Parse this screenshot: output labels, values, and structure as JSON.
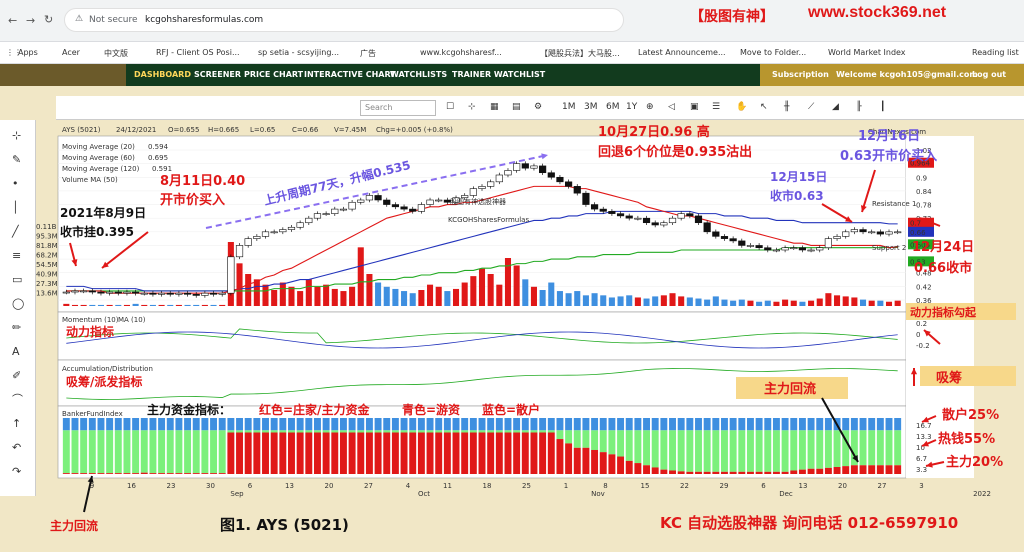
{
  "browser": {
    "url_security": "Not secure",
    "url": "kcgohsharesformulas.com",
    "banner_brand": "【股图有神】",
    "banner_site": "www.stock369.net",
    "bookmarks": [
      "Apps",
      "Acer",
      "中文版",
      "RFJ - Client OS Posi...",
      "sp setia - scsyijing...",
      "广告",
      "www.kcgohsharesf...",
      "【飓股兵法】大马股...",
      "Latest Announceme...",
      "Move to Folder...",
      "World Market Index",
      "Reading list"
    ]
  },
  "site_nav": {
    "items": [
      "DASHBOARD",
      "SCREENER",
      "PRICE CHART",
      "INTERACTIVE CHART",
      "WATCHLISTS",
      "TRAINER WATCHLIST"
    ],
    "subscription": "Subscription",
    "welcome": "Welcome kcgoh105@gmail.com",
    "logout": "Log out"
  },
  "toolbar": {
    "search_placeholder": "Search",
    "periods": [
      "1M",
      "3M",
      "6M",
      "1Y"
    ]
  },
  "quote": {
    "symbol": "AYS (5021)",
    "date": "24/12/2021",
    "open": "O=0.655",
    "high": "H=0.665",
    "low": "L=0.65",
    "close": "C=0.66",
    "volume": "V=7.45M",
    "change": "Chg=+0.005 (+0.8%)",
    "watermark": "ChartNexus.com"
  },
  "legend": {
    "ma20": "Moving Average (20)",
    "ma20_val": "0.594",
    "ma60": "Moving Average (60)",
    "ma60_val": "0.695",
    "ma120": "Moving Average (120)",
    "ma120_val": "0.591",
    "vma": "Volume MA (50)",
    "momentum": "Momentum (10)",
    "momentum_ma": "MA (10)",
    "accdist": "Accumulation/Distribution",
    "banker": "BankerFundIndex"
  },
  "colors": {
    "up": "#111111",
    "down": "#e01818",
    "ma20": "#e01818",
    "ma60": "#2233bb",
    "ma120": "#22aa22",
    "red_bar": "#e01818",
    "green_bar": "#7cf07c",
    "blue_bar": "#3e8fe0",
    "annotation_red": "#e01818",
    "annotation_purple": "#6a55e0"
  },
  "annotations": {
    "a1": "2021年8月9日",
    "a1b": "收市挂0.395",
    "a2": "8月11日0.40",
    "a2b": "开市价买入",
    "a3": "上升周期77天，升幅0.535",
    "a4": "10月27日0.96 高",
    "a5": "回退6个价位是0.935沽出",
    "a6": "12月16日",
    "a6b": "0.63开市价买入",
    "a7": "12月15日",
    "a7b": "收市0.63",
    "a8": "12月24日",
    "a8b": "0.66收市",
    "a9": "动力指标勾起",
    "a10": "动力指标",
    "a11": "吸筹/派发指标",
    "a12": "吸筹",
    "a13": "主力回流",
    "a14": "主力资金指标：",
    "a14r": "红色=庄家/主力资金",
    "a14g": "青色=游资",
    "a14b": "蓝色=散户",
    "a15": "散户25%",
    "a16": "热钱55%",
    "a17": "主力20%",
    "a18": "主力回流",
    "figure": "图1. AYS (5021)",
    "footer": "KC 自动选股神器 询问电话 012-6597910",
    "watermark_cn": "股图有神选股神器",
    "watermark_en": "KCGOHSharesFormulas",
    "support": "Support 2",
    "resistance": "Resistance 1"
  },
  "chart_data": {
    "type": "candlestick",
    "x_ticks": [
      "9",
      "16",
      "23",
      "30",
      "6",
      "13",
      "20",
      "27",
      "4",
      "11",
      "18",
      "25",
      "1",
      "8",
      "15",
      "22",
      "29",
      "6",
      "13",
      "20",
      "27",
      "3"
    ],
    "x_months": [
      "Sep",
      "Oct",
      "Nov",
      "Dec",
      "2022"
    ],
    "price_ticks": [
      "1.02",
      "0.96",
      "0.9",
      "0.84",
      "0.78",
      "0.72",
      "0.66",
      "0.6",
      "0.54",
      "0.48",
      "0.42",
      "0.36"
    ],
    "price_left_ticks": [
      "0.11B",
      "95.3M",
      "81.8M",
      "68.2M",
      "54.5M",
      "40.9M",
      "27.3M",
      "13.6M"
    ],
    "momentum_ticks": [
      "0.2",
      "0",
      "-0.2"
    ],
    "banker_ticks": [
      "16.7",
      "13.3",
      "10",
      "6.7",
      "3.3"
    ],
    "last_labels": [
      "0.964",
      "0.7",
      "0.66",
      "0.605",
      "0.53"
    ],
    "ylim": [
      0.36,
      1.02
    ],
    "close": [
      0.395,
      0.4,
      0.4,
      0.395,
      0.39,
      0.395,
      0.39,
      0.395,
      0.39,
      0.39,
      0.385,
      0.39,
      0.385,
      0.39,
      0.385,
      0.38,
      0.39,
      0.385,
      0.39,
      0.55,
      0.6,
      0.63,
      0.64,
      0.66,
      0.66,
      0.67,
      0.68,
      0.7,
      0.72,
      0.74,
      0.74,
      0.76,
      0.76,
      0.79,
      0.8,
      0.82,
      0.8,
      0.78,
      0.77,
      0.76,
      0.75,
      0.78,
      0.8,
      0.8,
      0.79,
      0.81,
      0.82,
      0.85,
      0.86,
      0.88,
      0.91,
      0.93,
      0.96,
      0.94,
      0.95,
      0.92,
      0.9,
      0.88,
      0.86,
      0.83,
      0.78,
      0.76,
      0.75,
      0.74,
      0.73,
      0.72,
      0.72,
      0.7,
      0.69,
      0.7,
      0.72,
      0.74,
      0.73,
      0.7,
      0.66,
      0.64,
      0.63,
      0.62,
      0.6,
      0.6,
      0.59,
      0.58,
      0.58,
      0.59,
      0.59,
      0.58,
      0.58,
      0.59,
      0.63,
      0.64,
      0.66,
      0.67,
      0.66,
      0.66,
      0.65,
      0.66,
      0.66
    ],
    "ma20": [
      0.4,
      0.4,
      0.4,
      0.4,
      0.4,
      0.39,
      0.39,
      0.39,
      0.39,
      0.39,
      0.39,
      0.39,
      0.39,
      0.39,
      0.39,
      0.39,
      0.39,
      0.39,
      0.39,
      0.4,
      0.41,
      0.43,
      0.44,
      0.46,
      0.47,
      0.49,
      0.5,
      0.52,
      0.54,
      0.56,
      0.58,
      0.6,
      0.62,
      0.64,
      0.66,
      0.68,
      0.7,
      0.72,
      0.73,
      0.74,
      0.75,
      0.76,
      0.77,
      0.77,
      0.78,
      0.78,
      0.79,
      0.79,
      0.8,
      0.81,
      0.82,
      0.83,
      0.84,
      0.85,
      0.86,
      0.86,
      0.86,
      0.86,
      0.86,
      0.85,
      0.85,
      0.84,
      0.83,
      0.82,
      0.81,
      0.8,
      0.79,
      0.77,
      0.76,
      0.75,
      0.74,
      0.73,
      0.73,
      0.72,
      0.71,
      0.7,
      0.69,
      0.68,
      0.67,
      0.66,
      0.65,
      0.64,
      0.63,
      0.62,
      0.61,
      0.61,
      0.6,
      0.6,
      0.6,
      0.6,
      0.6,
      0.6,
      0.6,
      0.6,
      0.6,
      0.59,
      0.594
    ],
    "ma60": [
      0.42,
      0.42,
      0.42,
      0.41,
      0.41,
      0.41,
      0.41,
      0.41,
      0.41,
      0.4,
      0.4,
      0.4,
      0.4,
      0.4,
      0.4,
      0.4,
      0.4,
      0.4,
      0.4,
      0.4,
      0.41,
      0.41,
      0.42,
      0.42,
      0.43,
      0.43,
      0.44,
      0.45,
      0.45,
      0.46,
      0.47,
      0.48,
      0.49,
      0.5,
      0.51,
      0.52,
      0.53,
      0.54,
      0.55,
      0.56,
      0.57,
      0.58,
      0.59,
      0.6,
      0.61,
      0.62,
      0.63,
      0.64,
      0.65,
      0.66,
      0.67,
      0.68,
      0.69,
      0.7,
      0.71,
      0.71,
      0.72,
      0.72,
      0.73,
      0.73,
      0.74,
      0.74,
      0.74,
      0.75,
      0.75,
      0.75,
      0.75,
      0.75,
      0.75,
      0.75,
      0.75,
      0.75,
      0.75,
      0.74,
      0.74,
      0.74,
      0.73,
      0.73,
      0.73,
      0.72,
      0.72,
      0.72,
      0.71,
      0.71,
      0.71,
      0.7,
      0.7,
      0.7,
      0.7,
      0.7,
      0.7,
      0.7,
      0.7,
      0.7,
      0.7,
      0.695,
      0.695
    ],
    "ma120": [
      0.4,
      0.4,
      0.4,
      0.4,
      0.4,
      0.4,
      0.4,
      0.4,
      0.4,
      0.4,
      0.4,
      0.4,
      0.4,
      0.4,
      0.4,
      0.4,
      0.4,
      0.4,
      0.4,
      0.4,
      0.4,
      0.4,
      0.4,
      0.4,
      0.41,
      0.41,
      0.41,
      0.41,
      0.42,
      0.42,
      0.42,
      0.43,
      0.43,
      0.43,
      0.44,
      0.44,
      0.45,
      0.45,
      0.45,
      0.46,
      0.46,
      0.47,
      0.47,
      0.48,
      0.48,
      0.48,
      0.49,
      0.49,
      0.5,
      0.5,
      0.51,
      0.51,
      0.52,
      0.52,
      0.53,
      0.53,
      0.54,
      0.54,
      0.54,
      0.55,
      0.55,
      0.55,
      0.56,
      0.56,
      0.56,
      0.56,
      0.57,
      0.57,
      0.57,
      0.57,
      0.57,
      0.58,
      0.58,
      0.58,
      0.58,
      0.58,
      0.58,
      0.58,
      0.58,
      0.58,
      0.58,
      0.58,
      0.58,
      0.59,
      0.59,
      0.59,
      0.59,
      0.59,
      0.59,
      0.59,
      0.59,
      0.59,
      0.59,
      0.59,
      0.59,
      0.591,
      0.591
    ],
    "volume": [
      2,
      1,
      1,
      1,
      1,
      1,
      1,
      1,
      2,
      1,
      1,
      1,
      1,
      1,
      1,
      1,
      1,
      1,
      1,
      60,
      40,
      30,
      25,
      20,
      15,
      22,
      18,
      14,
      25,
      18,
      20,
      16,
      14,
      18,
      55,
      30,
      22,
      18,
      16,
      14,
      12,
      15,
      20,
      18,
      14,
      16,
      22,
      28,
      35,
      30,
      20,
      45,
      38,
      25,
      18,
      15,
      22,
      14,
      12,
      14,
      10,
      12,
      10,
      8,
      9,
      10,
      8,
      7,
      9,
      10,
      12,
      9,
      8,
      7,
      6,
      9,
      6,
      5,
      6,
      5,
      4,
      5,
      4,
      6,
      5,
      4,
      5,
      7,
      12,
      10,
      9,
      8,
      6,
      5,
      5,
      4,
      5
    ],
    "banker_red": [
      2,
      2,
      2,
      2,
      2,
      2,
      2,
      2,
      2,
      3,
      2,
      2,
      2,
      2,
      2,
      2,
      2,
      2,
      2,
      95,
      95,
      95,
      95,
      95,
      95,
      95,
      95,
      95,
      95,
      95,
      95,
      95,
      95,
      95,
      95,
      95,
      95,
      95,
      95,
      95,
      95,
      95,
      95,
      95,
      95,
      95,
      95,
      95,
      95,
      95,
      95,
      95,
      95,
      95,
      95,
      95,
      95,
      80,
      70,
      60,
      60,
      55,
      50,
      45,
      40,
      30,
      25,
      20,
      15,
      10,
      8,
      6,
      5,
      5,
      5,
      5,
      5,
      5,
      5,
      5,
      5,
      5,
      5,
      5,
      8,
      10,
      12,
      12,
      14,
      16,
      18,
      20,
      20,
      20,
      20,
      20,
      20
    ]
  }
}
